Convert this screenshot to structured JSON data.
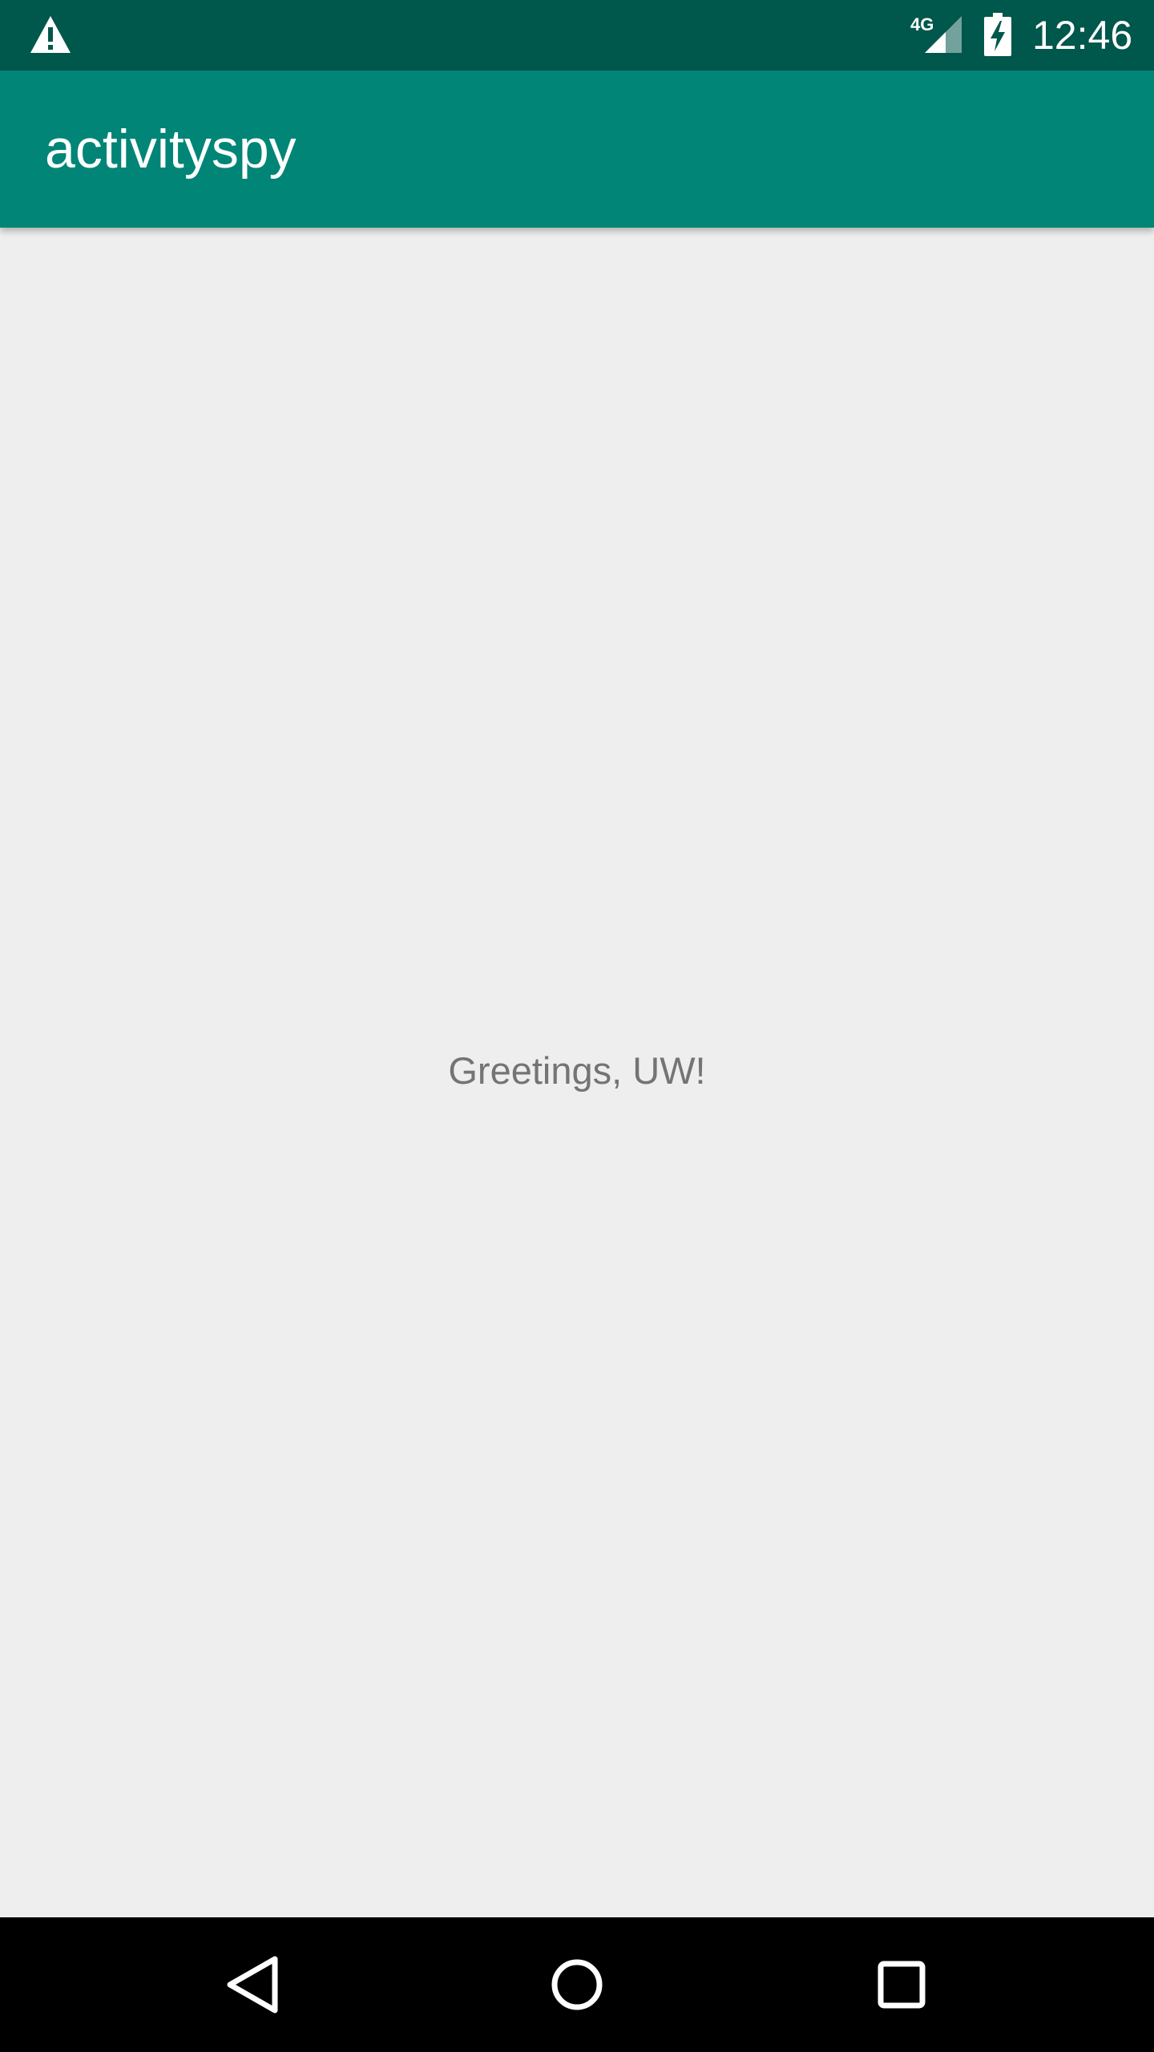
{
  "status_bar": {
    "network_label": "4G",
    "time": "12:46",
    "icons": [
      "warning-icon",
      "signal-icon",
      "battery-charging-icon"
    ]
  },
  "app_bar": {
    "title": "activityspy"
  },
  "main": {
    "greeting": "Greetings, UW!"
  },
  "nav_bar": {
    "icons": [
      "back-icon",
      "home-icon",
      "recents-icon"
    ]
  },
  "colors": {
    "status_bar": "#00574b",
    "app_bar": "#008577",
    "background": "#eeeeee",
    "text": "#747474",
    "nav_bar": "#000000"
  }
}
